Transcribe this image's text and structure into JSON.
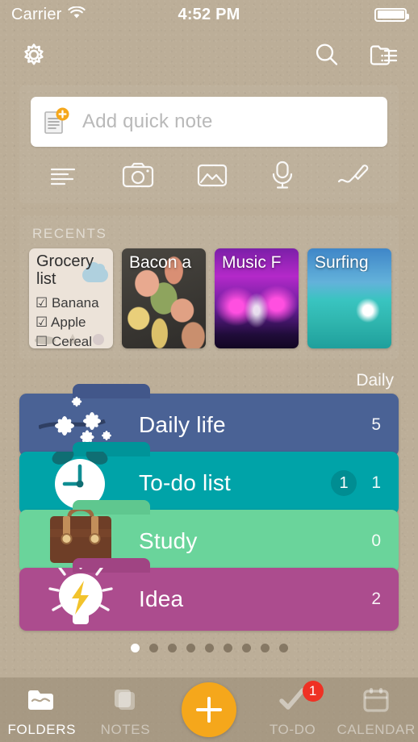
{
  "status_bar": {
    "carrier": "Carrier",
    "wifi_icon": "wifi-icon",
    "time": "4:52 PM",
    "battery_icon": "battery-full-icon"
  },
  "nav_bar": {
    "settings_icon": "gear-icon",
    "search_icon": "search-icon",
    "list_view_icon": "folder-list-icon"
  },
  "quick_note": {
    "placeholder": "Add quick note",
    "doc_icon": "document-plus-icon",
    "accent_color": "#f5a71b",
    "tools": [
      {
        "name": "text-icon"
      },
      {
        "name": "camera-icon"
      },
      {
        "name": "photo-icon"
      },
      {
        "name": "microphone-icon"
      },
      {
        "name": "brush-icon"
      }
    ]
  },
  "recents": {
    "title": "RECENTS",
    "items": [
      {
        "type": "note",
        "title": "Grocery list",
        "checklist": [
          {
            "checked": true,
            "text": "☑ Banana"
          },
          {
            "checked": true,
            "text": "☑ Apple"
          },
          {
            "checked": false,
            "text": "☐ Cereal"
          }
        ]
      },
      {
        "type": "photo",
        "title": "Bacon a",
        "style": "ph-bacon"
      },
      {
        "type": "photo",
        "title": "Music F",
        "style": "ph-music"
      },
      {
        "type": "photo",
        "title": "Surfing",
        "style": "ph-surf"
      }
    ]
  },
  "folders_section": {
    "group_label": "Daily",
    "items": [
      {
        "name": "Daily life",
        "count": "5",
        "badge": "",
        "color": "#4a6295",
        "tab_color": "#42578a",
        "icon": "blossom-icon"
      },
      {
        "name": "To-do list",
        "count": "1",
        "badge": "1",
        "color": "#00a3a8",
        "tab_color": "#009499",
        "icon": "alarm-clock-icon"
      },
      {
        "name": "Study",
        "count": "0",
        "badge": "",
        "color": "#6ad49b",
        "tab_color": "#5fc78f",
        "icon": "briefcase-icon"
      },
      {
        "name": "Idea",
        "count": "2",
        "badge": "",
        "color": "#ac4c8e",
        "tab_color": "#a04483",
        "icon": "lightbulb-icon"
      }
    ]
  },
  "pagination": {
    "total": 9,
    "active_index": 0
  },
  "tab_bar": {
    "items": [
      {
        "label": "FOLDERS",
        "icon": "folder-icon",
        "active": true,
        "badge": ""
      },
      {
        "label": "NOTES",
        "icon": "notes-icon",
        "active": false,
        "badge": ""
      },
      {
        "label": "TO-DO",
        "icon": "checkmark-icon",
        "active": false,
        "badge": "1"
      },
      {
        "label": "CALENDAR",
        "icon": "calendar-icon",
        "active": false,
        "badge": ""
      }
    ],
    "add_button": {
      "name": "add-button",
      "color": "#f5a71b"
    },
    "badge_color": "#ef3124"
  }
}
